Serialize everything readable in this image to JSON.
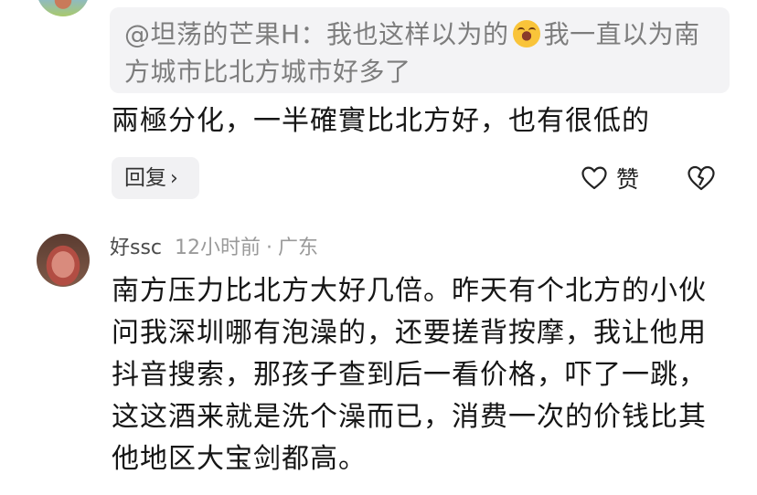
{
  "top_comment": {
    "quote": {
      "prefix": "@坦荡的芒果H：我也这样以为的",
      "emoji_icon": "laughing-crying-emoji-icon",
      "suffix": "我一直以为南方城市比北方城市好多了"
    },
    "body": "兩極分化，一半確實比北方好，也有很低的",
    "reply_label": "回复",
    "reply_chevron": "›",
    "like_label": "赞"
  },
  "second_comment": {
    "username": "好ssc",
    "time": "12小时前",
    "separator": "·",
    "location": "广东",
    "body": "南方压力比北方大好几倍。昨天有个北方的小伙问我深圳哪有泡澡的，还要搓背按摩，我让他用抖音搜索，那孩子查到后一看价格，吓了一跳，这这酒来就是洗个澡而已，消费一次的价钱比其他地区大宝剑都高。"
  },
  "colors": {
    "quote_bg": "#f3f3f5",
    "button_bg": "#f1f1f3",
    "muted_text": "#9a9a9a",
    "body_text": "#161616"
  }
}
